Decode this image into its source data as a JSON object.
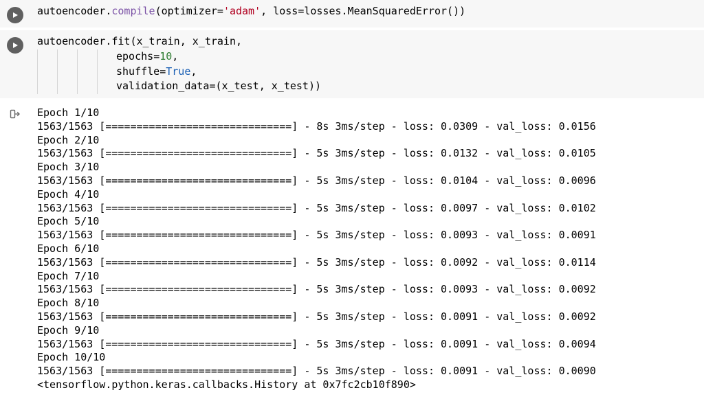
{
  "cell1": {
    "code": {
      "obj": "autoencoder",
      "method": "compile",
      "optimizer_kw": "optimizer",
      "optimizer_val": "'adam'",
      "loss_kw": "loss",
      "loss_val": "losses.MeanSquaredError()"
    }
  },
  "cell2": {
    "code": {
      "line1": "autoencoder.fit(x_train, x_train,",
      "epochs_kw": "epochs",
      "epochs_val": "10",
      "shuffle_kw": "shuffle",
      "shuffle_val": "True",
      "validation_kw": "validation_data",
      "validation_val": "(x_test, x_test))"
    }
  },
  "output": {
    "bar": "[==============================]",
    "epochs": [
      {
        "label": "Epoch 1/10",
        "progress": "1563/1563",
        "time": "8s 3ms/step",
        "loss": "0.0309",
        "val_loss": "0.0156"
      },
      {
        "label": "Epoch 2/10",
        "progress": "1563/1563",
        "time": "5s 3ms/step",
        "loss": "0.0132",
        "val_loss": "0.0105"
      },
      {
        "label": "Epoch 3/10",
        "progress": "1563/1563",
        "time": "5s 3ms/step",
        "loss": "0.0104",
        "val_loss": "0.0096"
      },
      {
        "label": "Epoch 4/10",
        "progress": "1563/1563",
        "time": "5s 3ms/step",
        "loss": "0.0097",
        "val_loss": "0.0102"
      },
      {
        "label": "Epoch 5/10",
        "progress": "1563/1563",
        "time": "5s 3ms/step",
        "loss": "0.0093",
        "val_loss": "0.0091"
      },
      {
        "label": "Epoch 6/10",
        "progress": "1563/1563",
        "time": "5s 3ms/step",
        "loss": "0.0092",
        "val_loss": "0.0114"
      },
      {
        "label": "Epoch 7/10",
        "progress": "1563/1563",
        "time": "5s 3ms/step",
        "loss": "0.0093",
        "val_loss": "0.0092"
      },
      {
        "label": "Epoch 8/10",
        "progress": "1563/1563",
        "time": "5s 3ms/step",
        "loss": "0.0091",
        "val_loss": "0.0092"
      },
      {
        "label": "Epoch 9/10",
        "progress": "1563/1563",
        "time": "5s 3ms/step",
        "loss": "0.0091",
        "val_loss": "0.0094"
      },
      {
        "label": "Epoch 10/10",
        "progress": "1563/1563",
        "time": "5s 3ms/step",
        "loss": "0.0091",
        "val_loss": "0.0090"
      }
    ],
    "footer": "<tensorflow.python.keras.callbacks.History at 0x7fc2cb10f890>"
  }
}
